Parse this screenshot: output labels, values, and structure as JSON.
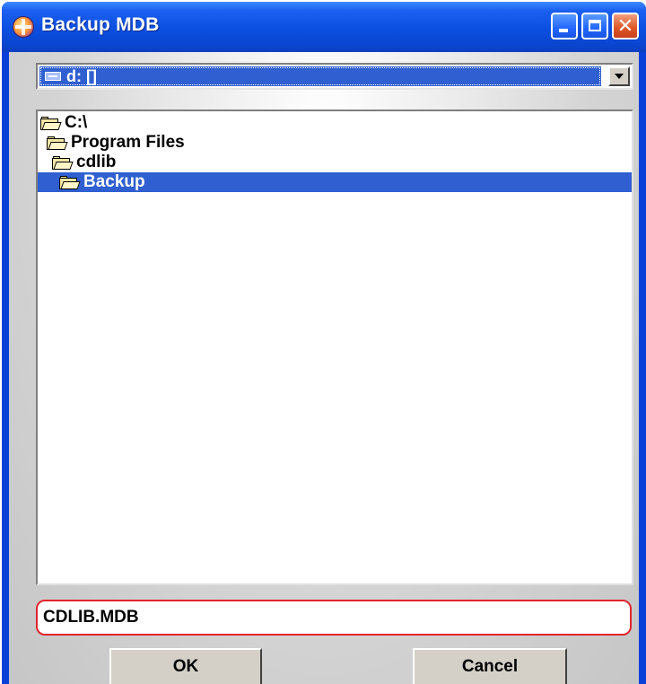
{
  "window": {
    "title": "Backup MDB"
  },
  "titlebar": {
    "minimize_icon": "minimize-icon",
    "maximize_icon": "maximize-icon",
    "close_icon": "close-icon",
    "close_glyph": "✕"
  },
  "drive": {
    "selected": "d: []",
    "icon": "drive-icon"
  },
  "directories": [
    {
      "label": "C:\\",
      "selected": false
    },
    {
      "label": "Program Files",
      "selected": false
    },
    {
      "label": "cdlib",
      "selected": false
    },
    {
      "label": "Backup",
      "selected": true
    }
  ],
  "file": {
    "value": "CDLIB.MDB"
  },
  "buttons": {
    "ok": "OK",
    "cancel": "Cancel"
  },
  "colors": {
    "titlebar": "#0b4fe0",
    "selection": "#2f5fd0",
    "highlight_outline": "#e0262d"
  }
}
